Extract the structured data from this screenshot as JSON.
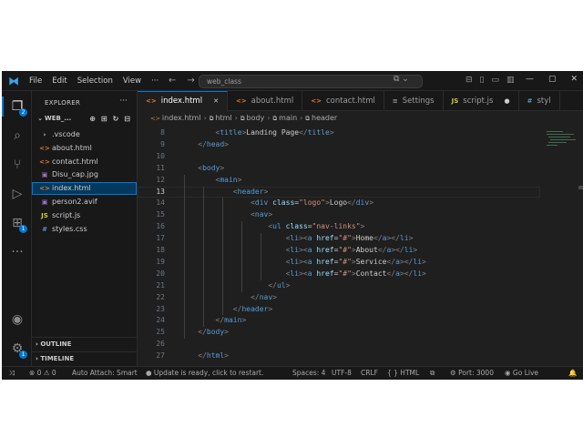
{
  "menu": [
    "File",
    "Edit",
    "Selection",
    "View"
  ],
  "search": {
    "text": "web_class"
  },
  "title_icons": {
    "nav_back": "←",
    "nav_forward": "→",
    "copilot": "⧉ ⌄",
    "layout": [
      "⊟",
      "▯",
      "▭",
      "▥"
    ],
    "window": [
      "—",
      "▢",
      "✕"
    ]
  },
  "activity": {
    "explorer_badge": "2",
    "extensions_badge": "1",
    "settings_badge": "1"
  },
  "sidebar": {
    "title": "EXPLORER",
    "dots": "···",
    "folder": "WEB_...",
    "tools": [
      "⊕",
      "⊞",
      "↻",
      "⊟"
    ],
    "files": [
      {
        "icon": "›",
        "name": ".vscode",
        "color": "#cccccc"
      },
      {
        "icon": "<>",
        "name": "about.html",
        "color": "#e37933"
      },
      {
        "icon": "<>",
        "name": "contact.html",
        "color": "#e37933"
      },
      {
        "icon": "▣",
        "name": "Disu_cap.jpg",
        "color": "#a074c4"
      },
      {
        "icon": "<>",
        "name": "index.html",
        "color": "#e37933"
      },
      {
        "icon": "▣",
        "name": "person2.avif",
        "color": "#a074c4"
      },
      {
        "icon": "JS",
        "name": "script.js",
        "color": "#cbcb41"
      },
      {
        "icon": "#",
        "name": "styles.css",
        "color": "#519aba"
      }
    ],
    "outline": "OUTLINE",
    "timeline": "TIMELINE"
  },
  "tabs": [
    {
      "icon": "<>",
      "label": "index.html",
      "end": "✕",
      "active": true
    },
    {
      "icon": "<>",
      "label": "about.html",
      "end": "",
      "active": false
    },
    {
      "icon": "<>",
      "label": "contact.html",
      "end": "",
      "active": false
    },
    {
      "icon": "≡",
      "label": "Settings",
      "end": "",
      "active": false
    },
    {
      "icon": "JS",
      "label": "script.js",
      "end": "●",
      "active": false
    },
    {
      "icon": "#",
      "label": "styl",
      "end": "",
      "active": false
    }
  ],
  "breadcrumb": [
    "index.html",
    "html",
    "body",
    "main",
    "header"
  ],
  "code": {
    "current_line": 13,
    "lines": [
      {
        "n": "8",
        "indent": "        ",
        "parts": [
          [
            "t",
            "<"
          ],
          [
            "n",
            "title"
          ],
          [
            "t",
            ">"
          ],
          [
            "x",
            "Landing Page"
          ],
          [
            "t",
            "</"
          ],
          [
            "n",
            "title"
          ],
          [
            "t",
            ">"
          ]
        ]
      },
      {
        "n": "9",
        "indent": "    ",
        "parts": [
          [
            "t",
            "</"
          ],
          [
            "n",
            "head"
          ],
          [
            "t",
            ">"
          ]
        ]
      },
      {
        "n": "10",
        "indent": "",
        "parts": []
      },
      {
        "n": "11",
        "indent": "    ",
        "parts": [
          [
            "t",
            "<"
          ],
          [
            "n",
            "body"
          ],
          [
            "t",
            ">"
          ]
        ]
      },
      {
        "n": "12",
        "indent": "        ",
        "parts": [
          [
            "t",
            "<"
          ],
          [
            "n",
            "main"
          ],
          [
            "t",
            ">"
          ]
        ]
      },
      {
        "n": "13",
        "indent": "            ",
        "parts": [
          [
            "t",
            "<"
          ],
          [
            "n",
            "header"
          ],
          [
            "t",
            ">"
          ]
        ]
      },
      {
        "n": "14",
        "indent": "                ",
        "parts": [
          [
            "t",
            "<"
          ],
          [
            "n",
            "div"
          ],
          [
            "x",
            " "
          ],
          [
            "a",
            "class"
          ],
          [
            "x",
            "="
          ],
          [
            "s",
            "\"logo\""
          ],
          [
            "t",
            ">"
          ],
          [
            "x",
            "Logo"
          ],
          [
            "t",
            "</"
          ],
          [
            "n",
            "div"
          ],
          [
            "t",
            ">"
          ]
        ]
      },
      {
        "n": "15",
        "indent": "                ",
        "parts": [
          [
            "t",
            "<"
          ],
          [
            "n",
            "nav"
          ],
          [
            "t",
            ">"
          ]
        ]
      },
      {
        "n": "16",
        "indent": "                    ",
        "parts": [
          [
            "t",
            "<"
          ],
          [
            "n",
            "ul"
          ],
          [
            "x",
            " "
          ],
          [
            "a",
            "class"
          ],
          [
            "x",
            "="
          ],
          [
            "s",
            "\"nav-links\""
          ],
          [
            "t",
            ">"
          ]
        ]
      },
      {
        "n": "17",
        "indent": "                        ",
        "parts": [
          [
            "t",
            "<"
          ],
          [
            "n",
            "li"
          ],
          [
            "t",
            "><"
          ],
          [
            "n",
            "a"
          ],
          [
            "x",
            " "
          ],
          [
            "a",
            "href"
          ],
          [
            "x",
            "="
          ],
          [
            "s",
            "\"#\""
          ],
          [
            "t",
            ">"
          ],
          [
            "x",
            "Home"
          ],
          [
            "t",
            "</"
          ],
          [
            "n",
            "a"
          ],
          [
            "t",
            "></"
          ],
          [
            "n",
            "li"
          ],
          [
            "t",
            ">"
          ]
        ]
      },
      {
        "n": "18",
        "indent": "                        ",
        "parts": [
          [
            "t",
            "<"
          ],
          [
            "n",
            "li"
          ],
          [
            "t",
            "><"
          ],
          [
            "n",
            "a"
          ],
          [
            "x",
            " "
          ],
          [
            "a",
            "href"
          ],
          [
            "x",
            "="
          ],
          [
            "s",
            "\"#\""
          ],
          [
            "t",
            ">"
          ],
          [
            "x",
            "About"
          ],
          [
            "t",
            "</"
          ],
          [
            "n",
            "a"
          ],
          [
            "t",
            "></"
          ],
          [
            "n",
            "li"
          ],
          [
            "t",
            ">"
          ]
        ]
      },
      {
        "n": "19",
        "indent": "                        ",
        "parts": [
          [
            "t",
            "<"
          ],
          [
            "n",
            "li"
          ],
          [
            "t",
            "><"
          ],
          [
            "n",
            "a"
          ],
          [
            "x",
            " "
          ],
          [
            "a",
            "href"
          ],
          [
            "x",
            "="
          ],
          [
            "s",
            "\"#\""
          ],
          [
            "t",
            ">"
          ],
          [
            "x",
            "Service"
          ],
          [
            "t",
            "</"
          ],
          [
            "n",
            "a"
          ],
          [
            "t",
            "></"
          ],
          [
            "n",
            "li"
          ],
          [
            "t",
            ">"
          ]
        ]
      },
      {
        "n": "20",
        "indent": "                        ",
        "parts": [
          [
            "t",
            "<"
          ],
          [
            "n",
            "li"
          ],
          [
            "t",
            "><"
          ],
          [
            "n",
            "a"
          ],
          [
            "x",
            " "
          ],
          [
            "a",
            "href"
          ],
          [
            "x",
            "="
          ],
          [
            "s",
            "\"#\""
          ],
          [
            "t",
            ">"
          ],
          [
            "x",
            "Contact"
          ],
          [
            "t",
            "</"
          ],
          [
            "n",
            "a"
          ],
          [
            "t",
            "></"
          ],
          [
            "n",
            "li"
          ],
          [
            "t",
            ">"
          ]
        ]
      },
      {
        "n": "21",
        "indent": "                    ",
        "parts": [
          [
            "t",
            "</"
          ],
          [
            "n",
            "ul"
          ],
          [
            "t",
            ">"
          ]
        ]
      },
      {
        "n": "22",
        "indent": "                ",
        "parts": [
          [
            "t",
            "</"
          ],
          [
            "n",
            "nav"
          ],
          [
            "t",
            ">"
          ]
        ]
      },
      {
        "n": "23",
        "indent": "            ",
        "parts": [
          [
            "t",
            "</"
          ],
          [
            "n",
            "header"
          ],
          [
            "t",
            ">"
          ]
        ]
      },
      {
        "n": "24",
        "indent": "        ",
        "parts": [
          [
            "t",
            "</"
          ],
          [
            "n",
            "main"
          ],
          [
            "t",
            ">"
          ]
        ]
      },
      {
        "n": "25",
        "indent": "    ",
        "parts": [
          [
            "t",
            "</"
          ],
          [
            "n",
            "body"
          ],
          [
            "t",
            ">"
          ]
        ]
      },
      {
        "n": "26",
        "indent": "",
        "parts": []
      },
      {
        "n": "27",
        "indent": "    ",
        "parts": [
          [
            "t",
            "</"
          ],
          [
            "n",
            "html"
          ],
          [
            "t",
            ">"
          ]
        ]
      }
    ]
  },
  "status": {
    "remote": "⤨",
    "problems": "⊗ 0 ⚠ 0",
    "auto_attach": "Auto Attach: Smart",
    "update": "● Update is ready, click to restart.",
    "spaces": "Spaces: 4",
    "encoding": "UTF-8",
    "eol": "CRLF",
    "language": "{ } HTML",
    "port": "⚙ Port: 3000",
    "golive": "◉ Go Live",
    "bell": "🔔"
  },
  "colors": {
    "accent": "#0078d4",
    "html_icon": "#e37933",
    "js_icon": "#cbcb41",
    "css_icon": "#519aba",
    "img_icon": "#a074c4"
  }
}
